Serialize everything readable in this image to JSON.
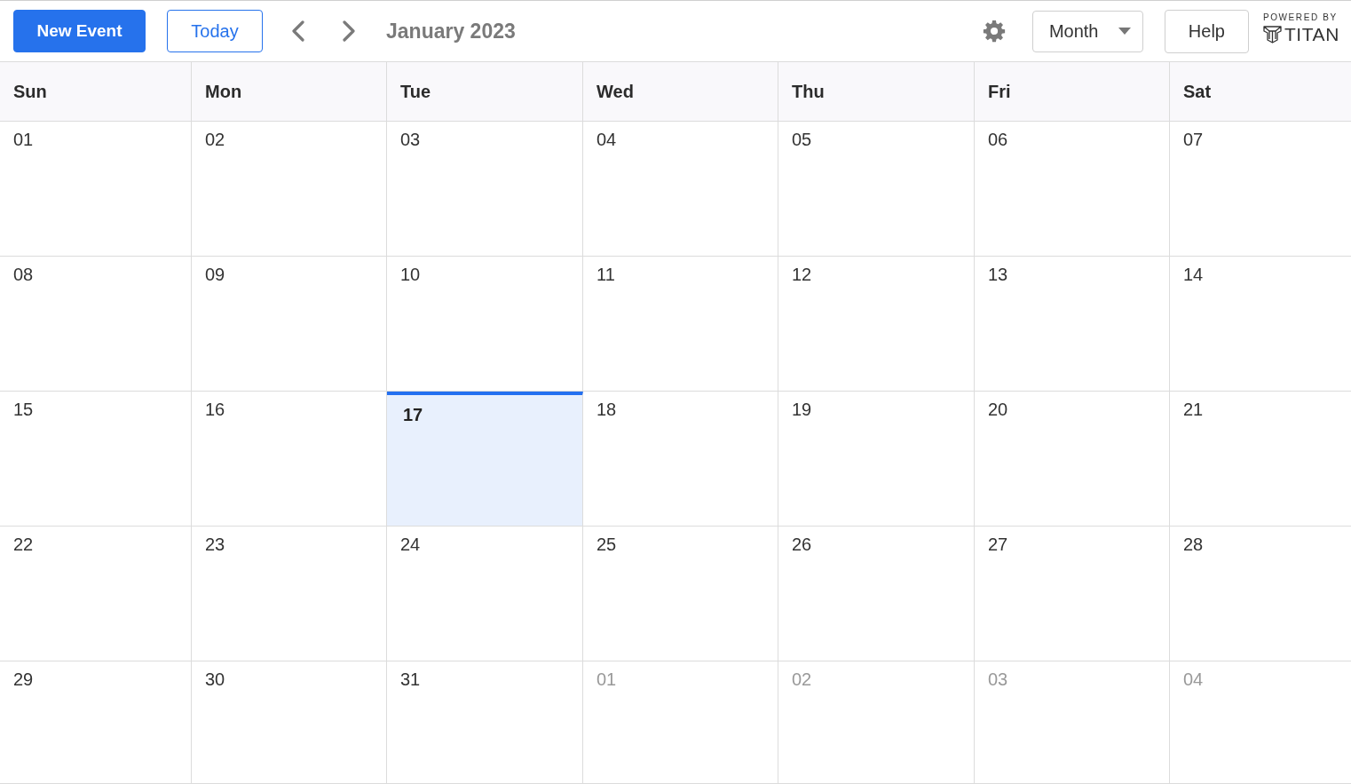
{
  "toolbar": {
    "new_event_button": "New Event",
    "today_button": "Today",
    "title": "January 2023",
    "view_select": {
      "value": "Month"
    },
    "help_button": "Help",
    "branding": {
      "caption": "POWERED BY",
      "name": "TITAN"
    }
  },
  "calendar": {
    "weekdays": [
      "Sun",
      "Mon",
      "Tue",
      "Wed",
      "Thu",
      "Fri",
      "Sat"
    ],
    "weeks": [
      {
        "days": [
          {
            "label": "01",
            "other_month": false,
            "today": false
          },
          {
            "label": "02",
            "other_month": false,
            "today": false
          },
          {
            "label": "03",
            "other_month": false,
            "today": false
          },
          {
            "label": "04",
            "other_month": false,
            "today": false
          },
          {
            "label": "05",
            "other_month": false,
            "today": false
          },
          {
            "label": "06",
            "other_month": false,
            "today": false
          },
          {
            "label": "07",
            "other_month": false,
            "today": false
          }
        ]
      },
      {
        "days": [
          {
            "label": "08",
            "other_month": false,
            "today": false
          },
          {
            "label": "09",
            "other_month": false,
            "today": false
          },
          {
            "label": "10",
            "other_month": false,
            "today": false
          },
          {
            "label": "11",
            "other_month": false,
            "today": false
          },
          {
            "label": "12",
            "other_month": false,
            "today": false
          },
          {
            "label": "13",
            "other_month": false,
            "today": false
          },
          {
            "label": "14",
            "other_month": false,
            "today": false
          }
        ]
      },
      {
        "days": [
          {
            "label": "15",
            "other_month": false,
            "today": false
          },
          {
            "label": "16",
            "other_month": false,
            "today": false
          },
          {
            "label": "17",
            "other_month": false,
            "today": true
          },
          {
            "label": "18",
            "other_month": false,
            "today": false
          },
          {
            "label": "19",
            "other_month": false,
            "today": false
          },
          {
            "label": "20",
            "other_month": false,
            "today": false
          },
          {
            "label": "21",
            "other_month": false,
            "today": false
          }
        ]
      },
      {
        "days": [
          {
            "label": "22",
            "other_month": false,
            "today": false
          },
          {
            "label": "23",
            "other_month": false,
            "today": false
          },
          {
            "label": "24",
            "other_month": false,
            "today": false
          },
          {
            "label": "25",
            "other_month": false,
            "today": false
          },
          {
            "label": "26",
            "other_month": false,
            "today": false
          },
          {
            "label": "27",
            "other_month": false,
            "today": false
          },
          {
            "label": "28",
            "other_month": false,
            "today": false
          }
        ]
      },
      {
        "days": [
          {
            "label": "29",
            "other_month": false,
            "today": false
          },
          {
            "label": "30",
            "other_month": false,
            "today": false
          },
          {
            "label": "31",
            "other_month": false,
            "today": false
          },
          {
            "label": "01",
            "other_month": true,
            "today": false
          },
          {
            "label": "02",
            "other_month": true,
            "today": false
          },
          {
            "label": "03",
            "other_month": true,
            "today": false
          },
          {
            "label": "04",
            "other_month": true,
            "today": false
          }
        ]
      }
    ]
  }
}
